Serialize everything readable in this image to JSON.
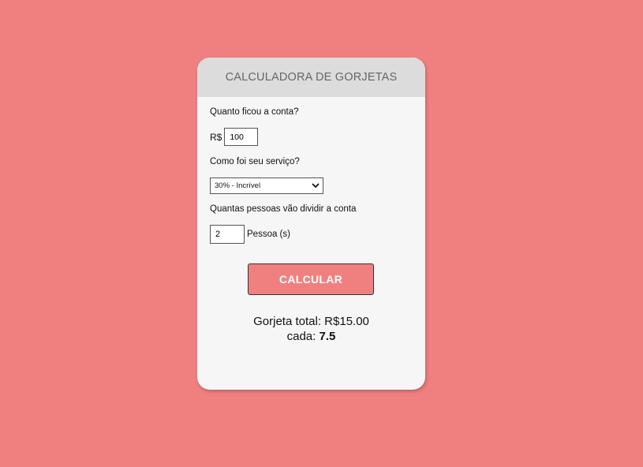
{
  "header": {
    "title": "CALCULADORA DE GORJETAS"
  },
  "bill": {
    "question": "Quanto ficou a conta?",
    "currency": "R$",
    "value": "100"
  },
  "service": {
    "question": "Como foi seu serviço?",
    "selected": "30% - Incrível"
  },
  "people": {
    "question": "Quantas pessoas vão dividir a conta",
    "value": "2",
    "unit": "Pessoa (s)"
  },
  "calculate_label": "CALCULAR",
  "result": {
    "total_label": "Gorjeta total:",
    "total_value": "R$15.00",
    "each_label": "cada:",
    "each_value": "7.5"
  },
  "colors": {
    "background": "#f08080",
    "card": "#f6f6f6",
    "header": "#dcdcdc",
    "button": "#f08080"
  },
  "icons": {
    "select_arrow": "chevron-down-icon"
  }
}
